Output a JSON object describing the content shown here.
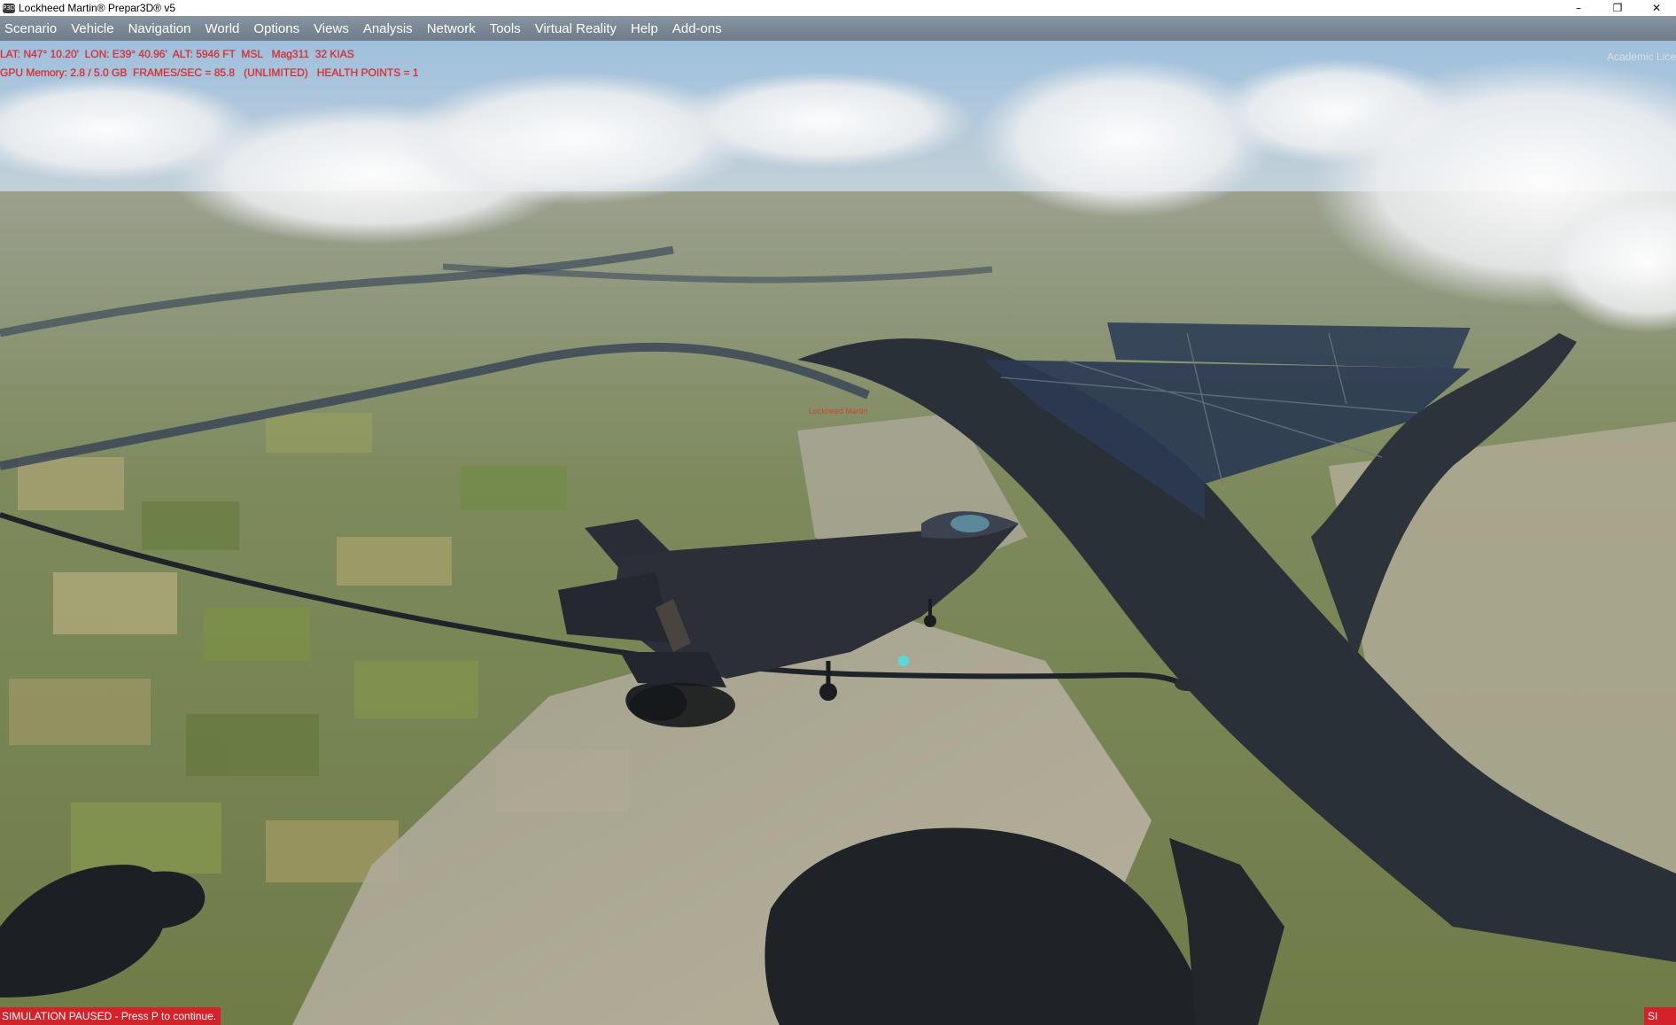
{
  "window": {
    "title": "Lockheed Martin® Prepar3D® v5",
    "icon": "p3d-app-icon",
    "controls": [
      "minimize",
      "restore",
      "close"
    ]
  },
  "menubar": {
    "items": [
      "Scenario",
      "Vehicle",
      "Navigation",
      "World",
      "Options",
      "Views",
      "Analysis",
      "Network",
      "Tools",
      "Virtual Reality",
      "Help",
      "Add-ons"
    ]
  },
  "hud": {
    "line1": "LAT: N47° 10.20'  LON: E39° 40.96'  ALT: 5946 FT  MSL   Mag311  32 KIAS",
    "line2": "GPU Memory: 2.8 / 5.0 GB  FRAMES/SEC = 85.8   (UNLIMITED)   HEALTH POINTS = 1",
    "color": "#ff1a1a"
  },
  "license_text": "Academic Lice",
  "scene_watermark": "Lockheed Martin",
  "status": {
    "left": "SIMULATION PAUSED - Press P to continue.",
    "right": "SI",
    "color": "#d3222a"
  }
}
